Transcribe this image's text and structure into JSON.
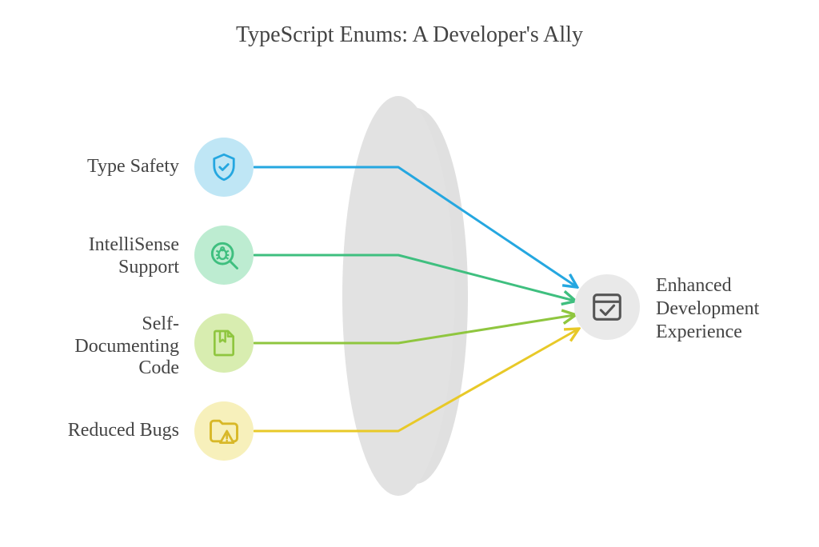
{
  "title": "TypeScript Enums: A Developer's Ally",
  "benefits": {
    "0": {
      "label": "Type Safety",
      "color": "#25a7e0",
      "bg": "#bfe6f5",
      "icon": "shield-check-icon"
    },
    "1": {
      "label": "IntelliSense\nSupport",
      "color": "#3fbf7f",
      "bg": "#bdecd1",
      "icon": "bug-search-icon"
    },
    "2": {
      "label": "Self-\nDocumenting\nCode",
      "color": "#8fc63f",
      "bg": "#d8edb0",
      "icon": "bookmark-file-icon"
    },
    "3": {
      "label": "Reduced Bugs",
      "color": "#e8c928",
      "bg": "#f7f0bb",
      "icon": "folder-warning-icon"
    }
  },
  "result": {
    "label": "Enhanced\nDevelopment\nExperience",
    "icon": "window-check-icon"
  }
}
